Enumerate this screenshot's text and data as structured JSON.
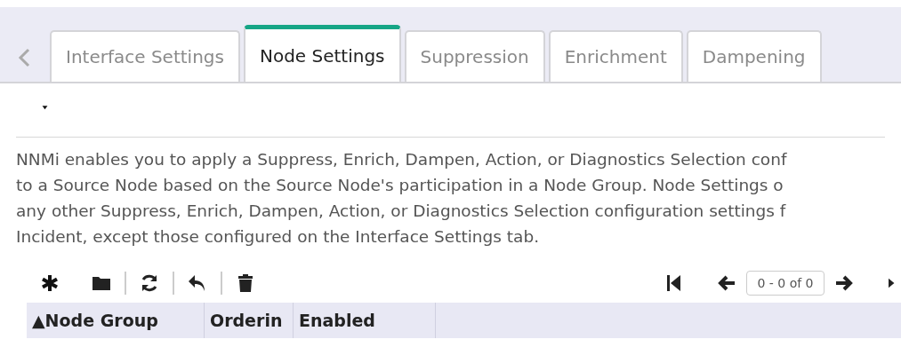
{
  "tabs": [
    {
      "label": "Interface Settings",
      "selected": false
    },
    {
      "label": "Node Settings",
      "selected": true
    },
    {
      "label": "Suppression",
      "selected": false
    },
    {
      "label": "Enrichment",
      "selected": false
    },
    {
      "label": "Dampening",
      "selected": false
    }
  ],
  "description": [
    "NNMi enables you to apply a Suppress, Enrich, Dampen, Action, or Diagnostics Selection conf",
    "to a Source Node based on the Source Node's participation in a Node Group. Node Settings o",
    "any other Suppress, Enrich, Dampen, Action, or Diagnostics Selection configuration settings f",
    "Incident, except those configured on the Interface Settings tab."
  ],
  "pager": {
    "value": "0 - 0 of 0"
  },
  "table": {
    "columns": [
      {
        "label": "▲Node Group"
      },
      {
        "label": "Orderin"
      },
      {
        "label": "Enabled"
      }
    ]
  }
}
